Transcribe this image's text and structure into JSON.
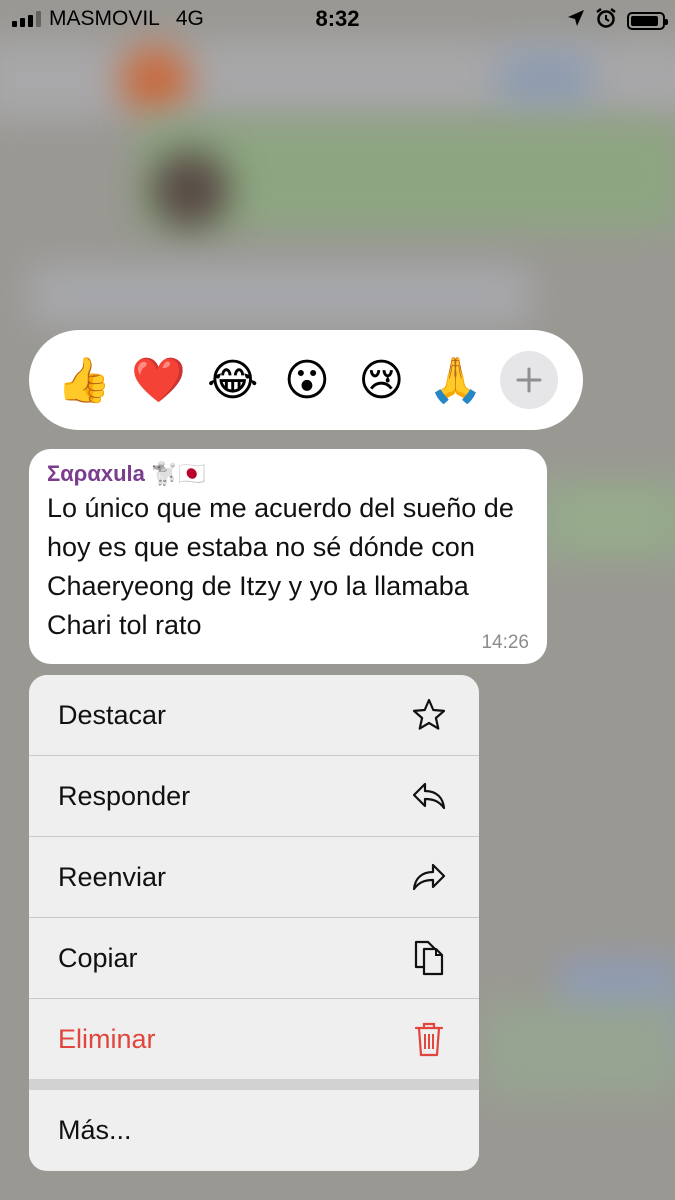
{
  "status_bar": {
    "carrier": "MASMOVIL",
    "network": "4G",
    "time": "8:32",
    "battery_level": 0.9
  },
  "reactions": [
    {
      "name": "thumbs-up",
      "glyph": "👍"
    },
    {
      "name": "heart",
      "glyph": "❤️"
    },
    {
      "name": "joy",
      "glyph": "😂"
    },
    {
      "name": "surprised",
      "glyph": "😮"
    },
    {
      "name": "cry",
      "glyph": "😢"
    },
    {
      "name": "pray",
      "glyph": "🙏"
    }
  ],
  "message": {
    "sender": "Σαραxula",
    "sender_emoji": "🐩🇯🇵",
    "text": "Lo único que me acuerdo del sueño de hoy es que estaba no sé dónde con Chaeryeong de Itzy y yo la llamaba Chari tol rato",
    "time": "14:26"
  },
  "menu": {
    "destacar": "Destacar",
    "responder": "Responder",
    "reenviar": "Reenviar",
    "copiar": "Copiar",
    "eliminar": "Eliminar",
    "mas": "Más..."
  },
  "colors": {
    "danger": "#e0463d",
    "sender": "#7b3d8d"
  }
}
